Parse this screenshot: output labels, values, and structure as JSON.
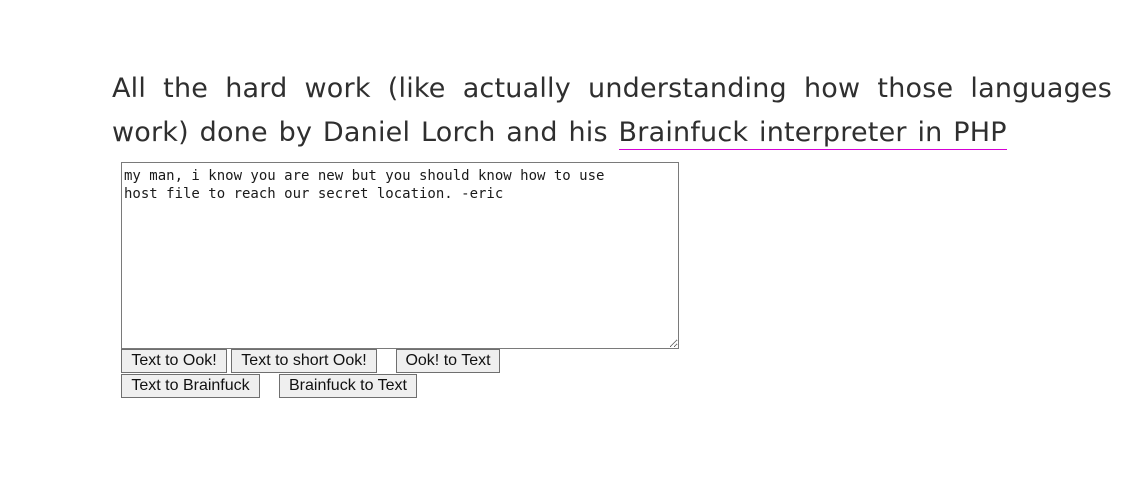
{
  "article": {
    "paragraph_text": "All the hard work (like actually understanding how those languages work) done by Daniel Lorch and his ",
    "link_text": "Brainfuck interpreter in PHP"
  },
  "editor": {
    "value": "my man, i know you are new but you should know how to use\nhost file to reach our secret location. -eric"
  },
  "buttons": {
    "text_to_ook": "Text to Ook!",
    "text_to_short_ook": "Text to short Ook!",
    "ook_to_text": "Ook! to Text",
    "text_to_brainfuck": "Text to Brainfuck",
    "brainfuck_to_text": "Brainfuck to Text"
  },
  "colors": {
    "text": "#2f2f2f",
    "link_underline": "#d400d4",
    "button_bg": "#efefef"
  }
}
